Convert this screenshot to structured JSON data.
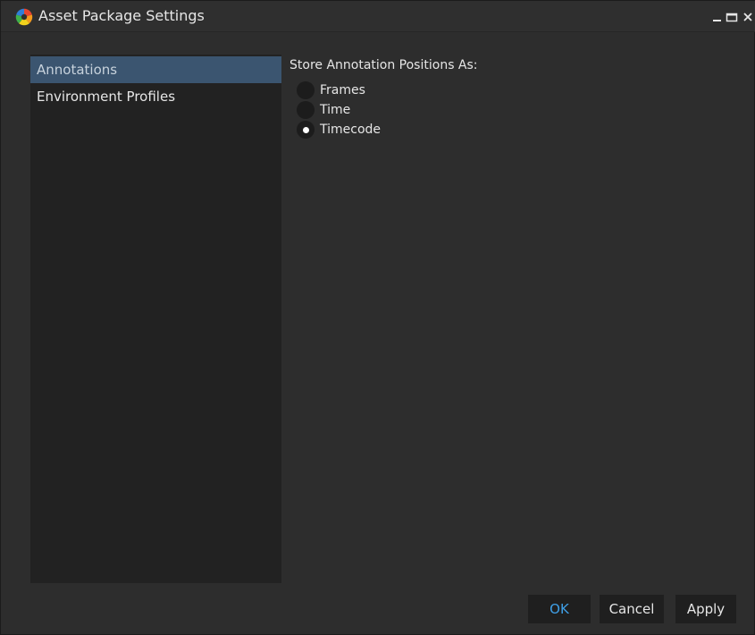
{
  "window": {
    "title": "Asset Package Settings",
    "icon": "app-aperture-icon",
    "controls": [
      "minimize-icon",
      "maximize-icon",
      "close-icon"
    ]
  },
  "sidebar": {
    "items": [
      {
        "label": "Annotations",
        "selected": true
      },
      {
        "label": "Environment Profiles",
        "selected": false
      }
    ]
  },
  "annotations": {
    "group_label": "Store Annotation Positions As:",
    "options": [
      {
        "label": "Frames",
        "checked": false
      },
      {
        "label": "Time",
        "checked": false
      },
      {
        "label": "Timecode",
        "checked": true
      }
    ]
  },
  "buttons": {
    "ok": "OK",
    "cancel": "Cancel",
    "apply": "Apply"
  },
  "colors": {
    "background": "#2d2d2d",
    "sidebar": "#222222",
    "selection": "#3b5570",
    "ok_text": "#3fa0e8",
    "text": "#e6e6e6"
  }
}
